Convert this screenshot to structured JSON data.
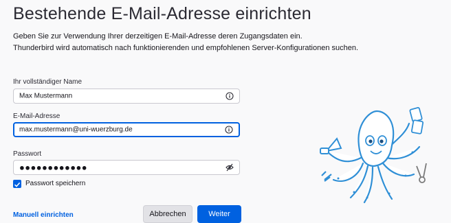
{
  "header": {
    "title": "Bestehende E-Mail-Adresse einrichten",
    "intro_line1": "Geben Sie zur Verwendung Ihrer derzeitigen E-Mail-Adresse deren Zugangsdaten ein.",
    "intro_line2": "Thunderbird wird automatisch nach funktionierenden und empfohlenen Server-Konfigurationen suchen."
  },
  "form": {
    "name": {
      "label": "Ihr vollständiger Name",
      "value": "Max Mustermann",
      "icon": "info-icon"
    },
    "email": {
      "label": "E-Mail-Adresse",
      "value": "max.mustermann@uni-wuerzburg.de",
      "icon": "info-icon"
    },
    "password": {
      "label": "Passwort",
      "value": "●●●●●●●●●●●●",
      "icon": "eye-slash-icon"
    },
    "remember": {
      "label": "Passwort speichern",
      "checked": true
    }
  },
  "actions": {
    "manual_link": "Manuell einrichten",
    "cancel": "Abbrechen",
    "next": "Weiter"
  },
  "colors": {
    "accent": "#0061e0",
    "mascot_outline": "#2f8fd6",
    "mascot_fill": "#ffffff"
  }
}
